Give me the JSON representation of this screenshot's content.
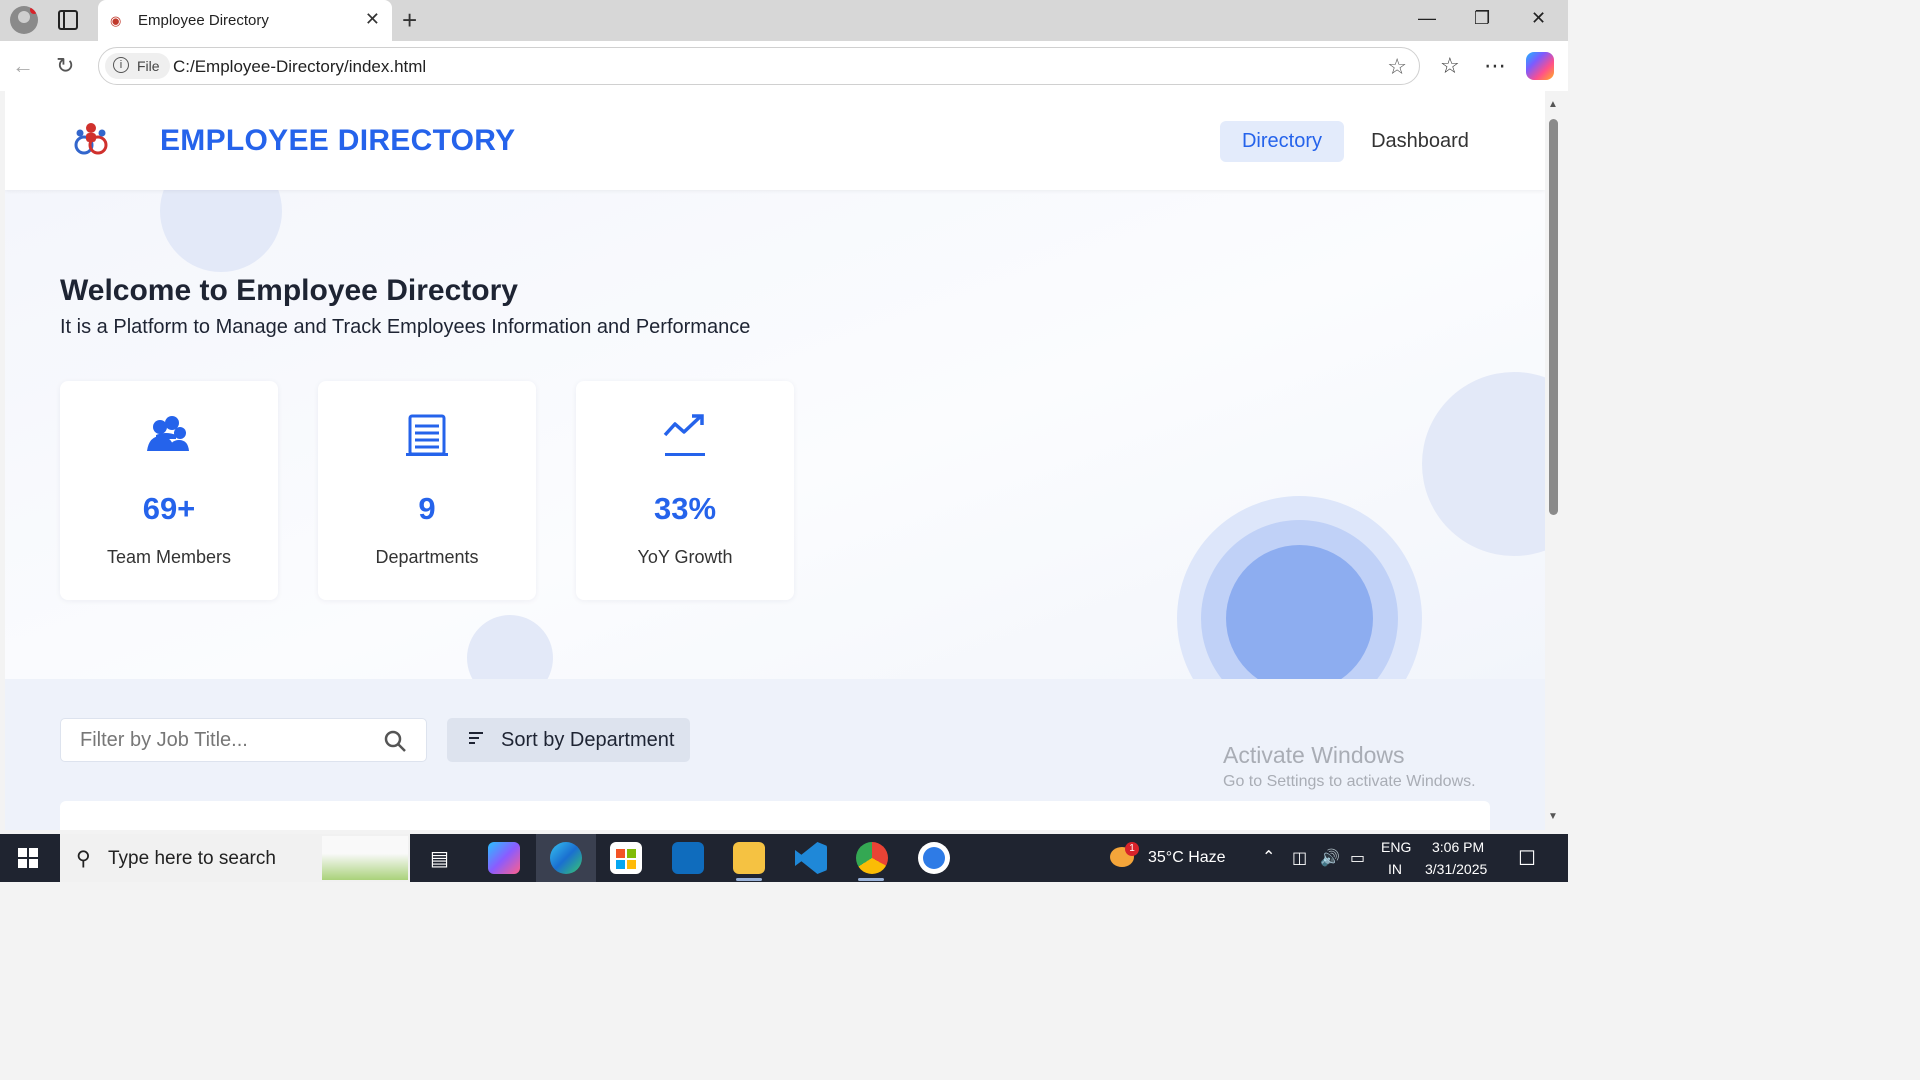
{
  "browser": {
    "tab_title": "Employee Directory",
    "file_label": "File",
    "url": "C:/Employee-Directory/index.html"
  },
  "app": {
    "brand": "EMPLOYEE DIRECTORY",
    "nav": [
      {
        "label": "Directory",
        "active": true
      },
      {
        "label": "Dashboard",
        "active": false
      }
    ],
    "colors": {
      "accent": "#2563eb",
      "nav_active_bg": "#e3ebfb"
    }
  },
  "hero": {
    "title": "Welcome to Employee Directory",
    "subtitle": "It is a Platform to Manage and Track Employees Information and Performance"
  },
  "stats": [
    {
      "icon": "team-icon",
      "value": "69+",
      "label": "Team Members"
    },
    {
      "icon": "building-icon",
      "value": "9",
      "label": "Departments"
    },
    {
      "icon": "trending-up-icon",
      "value": "33%",
      "label": "YoY Growth"
    }
  ],
  "filter": {
    "placeholder": "Filter by Job Title...",
    "sort_label": "Sort by Department"
  },
  "watermark": {
    "title": "Activate Windows",
    "subtitle": "Go to Settings to activate Windows."
  },
  "taskbar": {
    "search_placeholder": "Type here to search",
    "weather": "35°C  Haze",
    "weather_badge": "1",
    "lang_top": "ENG",
    "lang_bottom": "IN",
    "time": "3:06 PM",
    "date": "3/31/2025"
  }
}
